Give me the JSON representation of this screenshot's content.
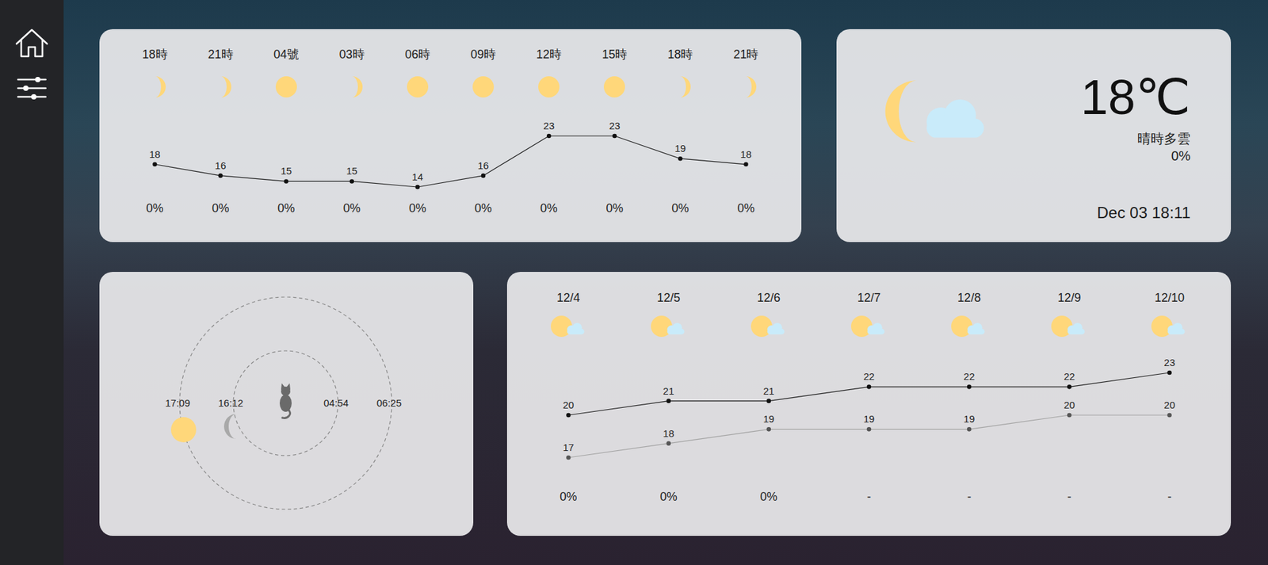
{
  "hourly": {
    "items": [
      {
        "time": "18時",
        "kind": "moon",
        "temp_label": "18",
        "pop": "0%"
      },
      {
        "time": "21時",
        "kind": "moon",
        "temp_label": "16",
        "pop": "0%"
      },
      {
        "time": "04號",
        "kind": "sun",
        "temp_label": "15",
        "pop": "0%"
      },
      {
        "time": "03時",
        "kind": "moon",
        "temp_label": "15",
        "pop": "0%"
      },
      {
        "time": "06時",
        "kind": "sun",
        "temp_label": "14",
        "pop": "0%"
      },
      {
        "time": "09時",
        "kind": "sun",
        "temp_label": "16",
        "pop": "0%"
      },
      {
        "time": "12時",
        "kind": "sun",
        "temp_label": "23",
        "pop": "0%"
      },
      {
        "time": "15時",
        "kind": "sun",
        "temp_label": "23",
        "pop": "0%"
      },
      {
        "time": "18時",
        "kind": "moon",
        "temp_label": "19",
        "pop": "0%"
      },
      {
        "time": "21時",
        "kind": "moon",
        "temp_label": "18",
        "pop": "0%"
      }
    ],
    "chart": {
      "values": [
        18,
        16,
        15,
        15,
        14,
        16,
        23,
        23,
        19,
        18
      ]
    }
  },
  "current": {
    "temperature": "18℃",
    "description": "晴時多雲",
    "pop": "0%",
    "datetime": "Dec 03 18:11"
  },
  "astro": {
    "sun": {
      "times": [
        "17:09",
        "06:25"
      ]
    },
    "moon": {
      "times": [
        "16:12",
        "04:54"
      ]
    }
  },
  "weekly": {
    "items": [
      {
        "date": "12/4",
        "max_label": "20",
        "min_label": "17",
        "pop": "0%"
      },
      {
        "date": "12/5",
        "max_label": "21",
        "min_label": "18",
        "pop": "0%"
      },
      {
        "date": "12/6",
        "max_label": "21",
        "min_label": "19",
        "pop": "0%"
      },
      {
        "date": "12/7",
        "max_label": "22",
        "min_label": "19",
        "pop": "-"
      },
      {
        "date": "12/8",
        "max_label": "22",
        "min_label": "19",
        "pop": "-"
      },
      {
        "date": "12/9",
        "max_label": "22",
        "min_label": "20",
        "pop": "-"
      },
      {
        "date": "12/10",
        "max_label": "23",
        "min_label": "20",
        "pop": "-"
      }
    ],
    "chart": {
      "max": [
        20,
        21,
        21,
        22,
        22,
        22,
        23
      ],
      "min": [
        17,
        18,
        19,
        19,
        19,
        20,
        20
      ]
    }
  }
}
